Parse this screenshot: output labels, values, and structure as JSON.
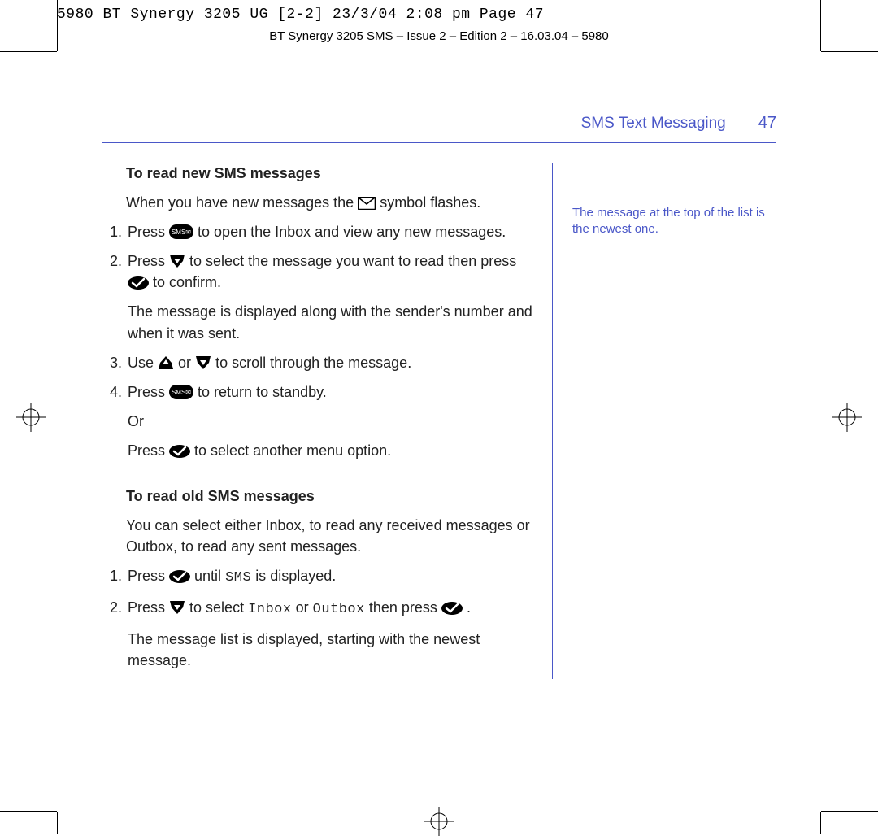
{
  "slug": "5980 BT Synergy 3205 UG [2-2]  23/3/04  2:08 pm  Page 47",
  "running_head": "BT Synergy 3205 SMS – Issue 2 – Edition 2 – 16.03.04 – 5980",
  "header": {
    "section": "SMS Text Messaging",
    "page": "47"
  },
  "side_note": "The message at the top of the list is the newest one.",
  "sec1": {
    "title": "To read new SMS messages",
    "intro_a": "When you have new messages the ",
    "intro_b": " symbol flashes.",
    "step1_a": "Press ",
    "step1_b": " to open the Inbox and view any new messages.",
    "step2_a": "Press ",
    "step2_b": " to select the message you want to read then press ",
    "step2_c": " to confirm.",
    "step2_note": "The message is displayed along with the sender's number and when it was sent.",
    "step3_a": "Use ",
    "step3_b": " or ",
    "step3_c": " to scroll through the message.",
    "step4_a": "Press ",
    "step4_b": " to return to standby.",
    "step4_or": "Or",
    "step4_c": "Press ",
    "step4_d": " to select another menu option."
  },
  "sec2": {
    "title": "To read old SMS messages",
    "intro": "You can select either Inbox, to read any received messages or Outbox, to read any sent messages.",
    "step1_a": "Press ",
    "step1_b": " until ",
    "step1_sms": "SMS",
    "step1_c": " is displayed.",
    "step2_a": "Press ",
    "step2_b": " to select ",
    "step2_inbox": "Inbox",
    "step2_or": " or ",
    "step2_outbox": "Outbox",
    "step2_c": " then press ",
    "step2_d": ".",
    "step2_note": "The message list is displayed, starting with the newest message."
  }
}
